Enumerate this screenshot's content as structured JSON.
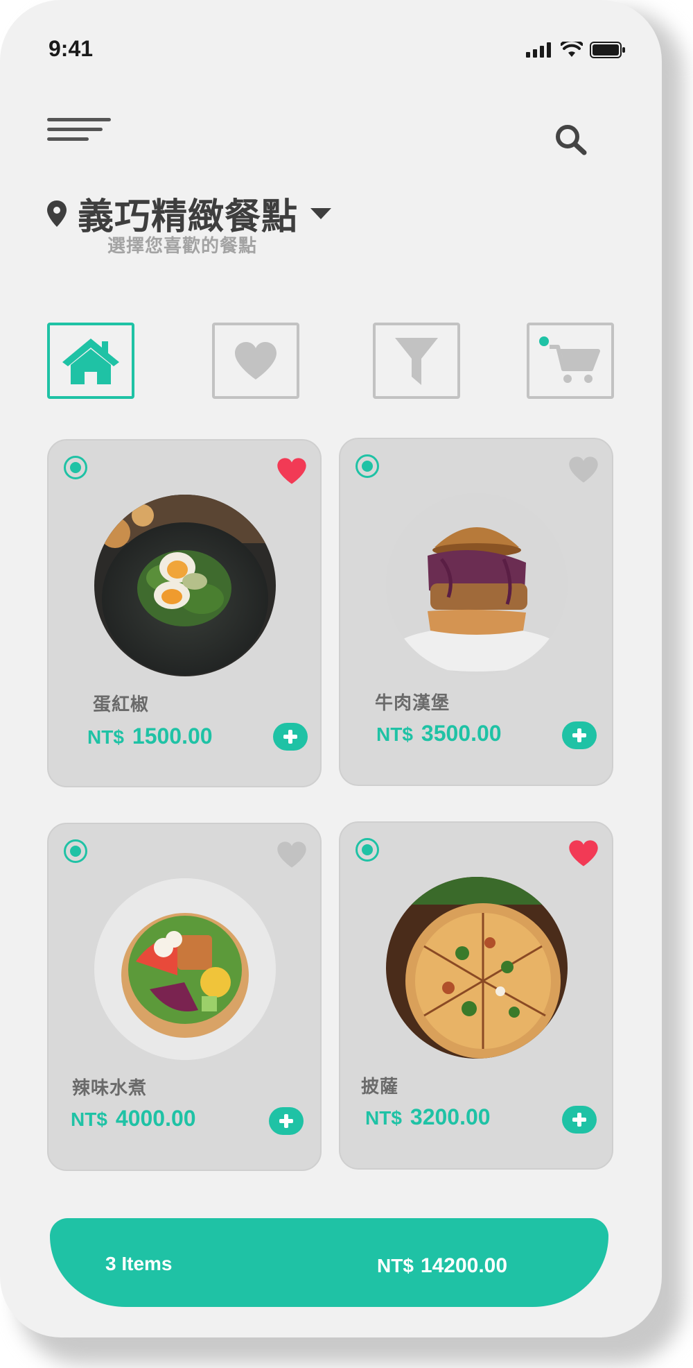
{
  "status_bar": {
    "time": "9:41"
  },
  "header": {
    "title": "義巧精緻餐點",
    "subtitle": "選擇您喜歡的餐點"
  },
  "tabs": [
    {
      "icon": "home-icon",
      "active": true
    },
    {
      "icon": "heart-icon",
      "active": false
    },
    {
      "icon": "filter-icon",
      "active": false
    },
    {
      "icon": "cart-icon",
      "active": false
    }
  ],
  "products": [
    {
      "name": "蛋紅椒",
      "currency": "NT$",
      "price": "1500.00",
      "favorite": true
    },
    {
      "name": "牛肉漢堡",
      "currency": "NT$",
      "price": "3500.00",
      "favorite": false
    },
    {
      "name": "辣味水煮",
      "currency": "NT$",
      "price": "4000.00",
      "favorite": false
    },
    {
      "name": "披薩",
      "currency": "NT$",
      "price": "3200.00",
      "favorite": true
    }
  ],
  "cart": {
    "items_label": "3 Items",
    "currency": "NT$",
    "total": "14200.00"
  },
  "colors": {
    "accent": "#1fc2a5",
    "favorite": "#f23a55",
    "inactive": "#c2c2c2"
  }
}
